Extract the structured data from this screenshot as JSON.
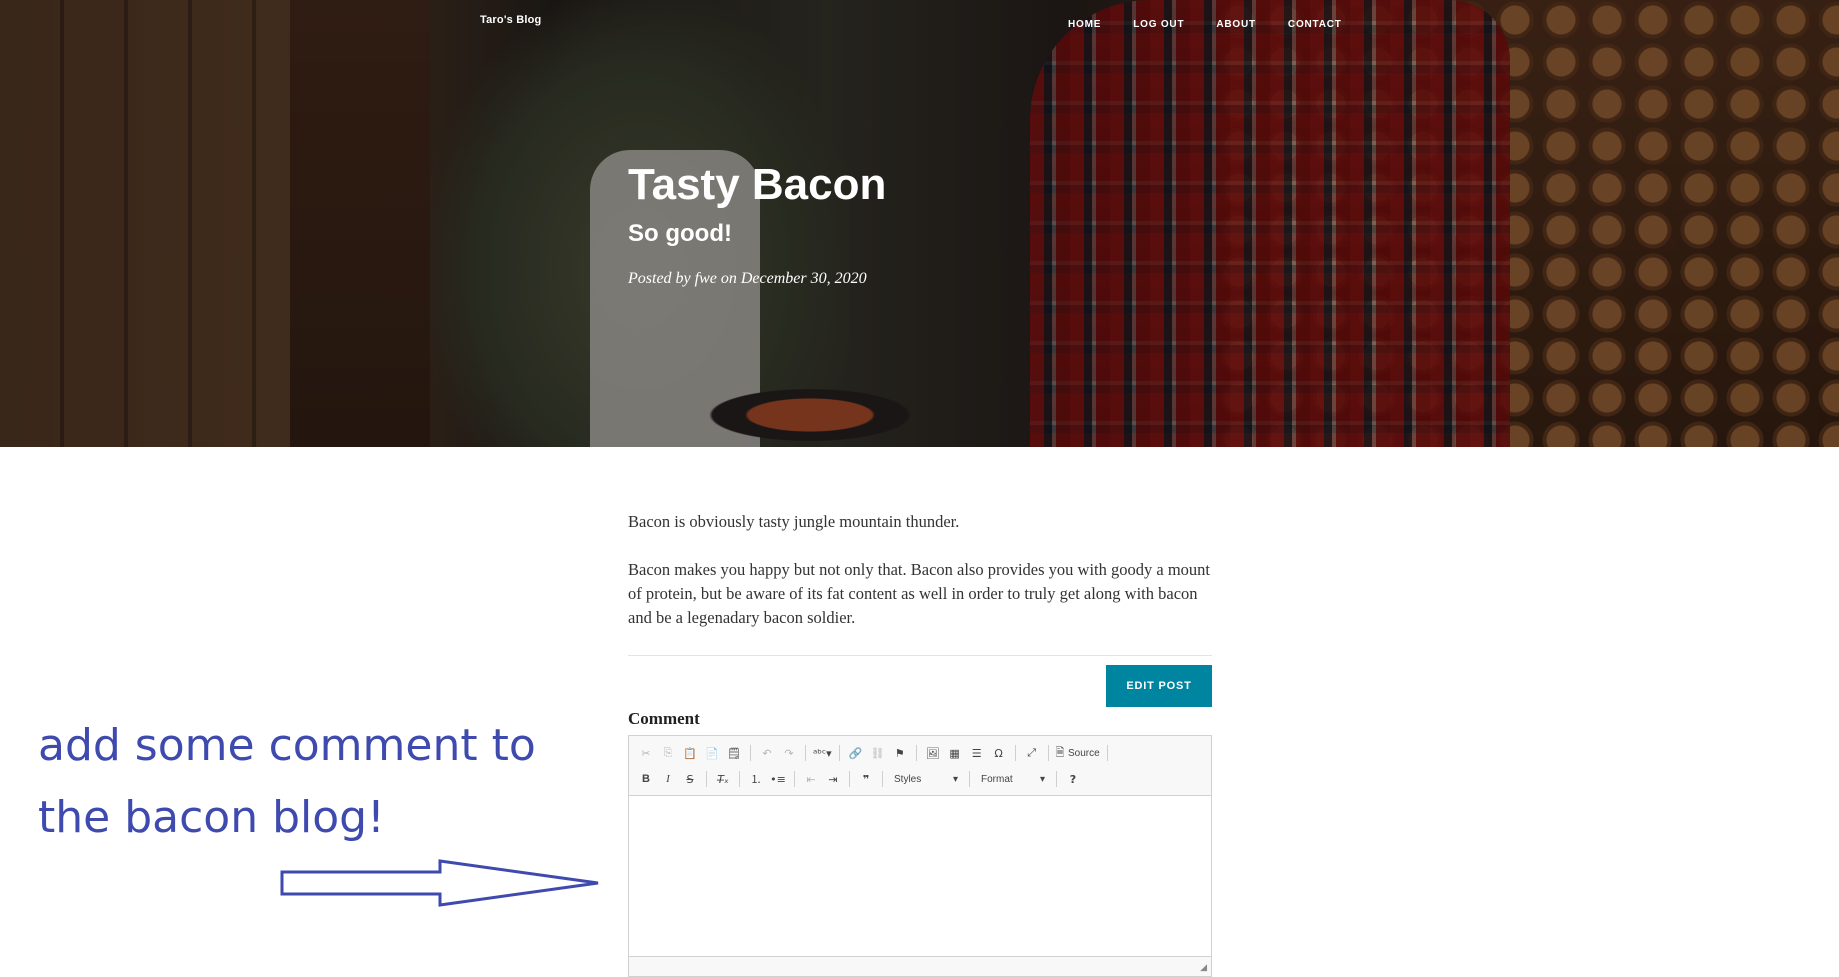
{
  "header": {
    "brand": "Taro's Blog",
    "nav": [
      {
        "label": "HOME"
      },
      {
        "label": "LOG OUT"
      },
      {
        "label": "ABOUT"
      },
      {
        "label": "CONTACT"
      }
    ],
    "title": "Tasty Bacon",
    "subtitle": "So good!",
    "meta": "Posted by fwe on December 30, 2020"
  },
  "post": {
    "paragraphs": [
      "Bacon is obviously tasty jungle mountain thunder.",
      "Bacon makes you happy but not only that. Bacon also provides you with goody a mount of protein, but be aware of its fat content as well in order to truly get along with bacon and be a legenadary bacon soldier."
    ],
    "edit_button": "EDIT POST"
  },
  "comment": {
    "label": "Comment",
    "toolbar": {
      "source_label": "Source",
      "styles_label": "Styles",
      "format_label": "Format",
      "help_label": "?"
    }
  },
  "annotation": {
    "text_line1": "add some comment to",
    "text_line2": "the bacon blog!",
    "color": "#3f4aaf"
  },
  "colors": {
    "accent": "#0085a1"
  }
}
